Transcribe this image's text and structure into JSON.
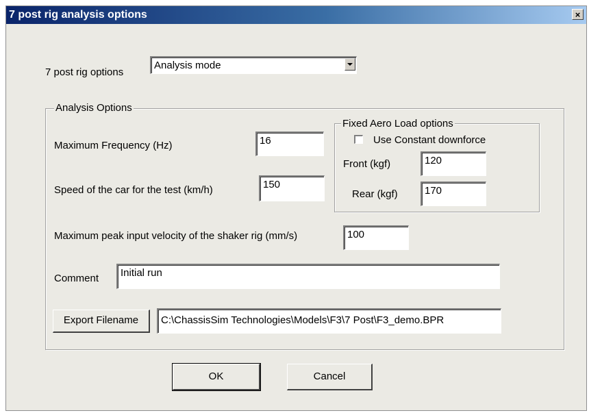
{
  "window": {
    "title": "7 post rig analysis options",
    "close_label": "×"
  },
  "rig_options": {
    "label": "7 post rig options",
    "selected": "Analysis mode"
  },
  "analysis_group": {
    "label": "Analysis Options",
    "max_frequency": {
      "label": "Maximum Frequency (Hz)",
      "value": "16"
    },
    "speed": {
      "label": "Speed of the car for the test (km/h)",
      "value": "150"
    },
    "max_velocity": {
      "label": "Maximum peak input velocity of the shaker rig (mm/s)",
      "value": "100"
    },
    "comment": {
      "label": "Comment",
      "value": "Initial run"
    },
    "export": {
      "button_label": "Export Filename",
      "value": "C:\\ChassisSim Technologies\\Models\\F3\\7 Post\\F3_demo.BPR"
    }
  },
  "aero_group": {
    "label": "Fixed Aero Load options",
    "use_constant_label": "Use Constant downforce",
    "use_constant_checked": false,
    "front": {
      "label": "Front (kgf)",
      "value": "120"
    },
    "rear": {
      "label": "Rear (kgf)",
      "value": "170"
    }
  },
  "buttons": {
    "ok": "OK",
    "cancel": "Cancel"
  }
}
